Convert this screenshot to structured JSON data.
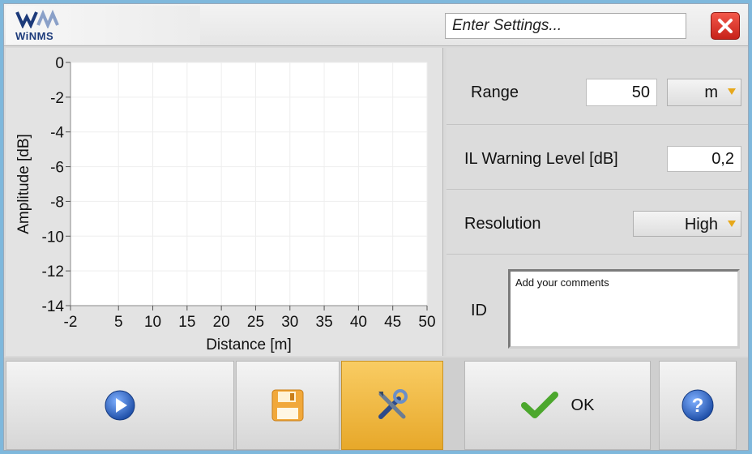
{
  "app": {
    "logo_text": "WiNMS"
  },
  "header": {
    "settings_title": "Enter Settings..."
  },
  "settings": {
    "range": {
      "label": "Range",
      "value": "50",
      "unit": "m"
    },
    "il_warning": {
      "label": "IL Warning Level [dB]",
      "value": "0,2"
    },
    "resolution": {
      "label": "Resolution",
      "value": "High"
    },
    "id": {
      "label": "ID",
      "placeholder": "Add your comments"
    }
  },
  "buttons": {
    "ok_label": "OK"
  },
  "chart_data": {
    "type": "line",
    "xlabel": "Distance [m]",
    "ylabel": "Amplitude [dB]",
    "xlim": [
      -2,
      50
    ],
    "ylim": [
      -14,
      0
    ],
    "x_ticks": [
      "-2",
      "5",
      "10",
      "15",
      "20",
      "25",
      "30",
      "35",
      "40",
      "45",
      "50"
    ],
    "y_ticks": [
      "0",
      "-2",
      "-4",
      "-6",
      "-8",
      "-10",
      "-12",
      "-14"
    ],
    "series": [],
    "grid": true
  },
  "colors": {
    "accent_active": "#e7a82a",
    "close_red": "#d9291f",
    "play_blue": "#2e6bc6"
  }
}
